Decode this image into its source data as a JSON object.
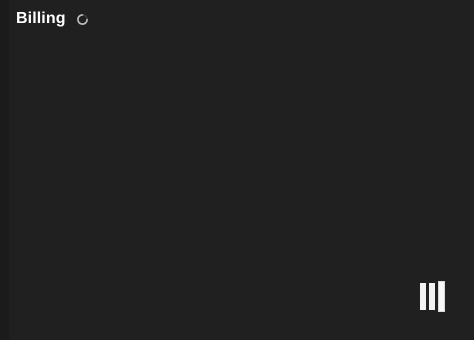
{
  "header": {
    "title": "Billing",
    "status_icon": "loading-spinner-icon"
  },
  "logo": {
    "icon": "vertical-bars-logo-icon"
  },
  "colors": {
    "background": "#202020",
    "title_text": "#ffffff",
    "spinner": "#bdbdbd",
    "logo": "#f2f2f2"
  }
}
